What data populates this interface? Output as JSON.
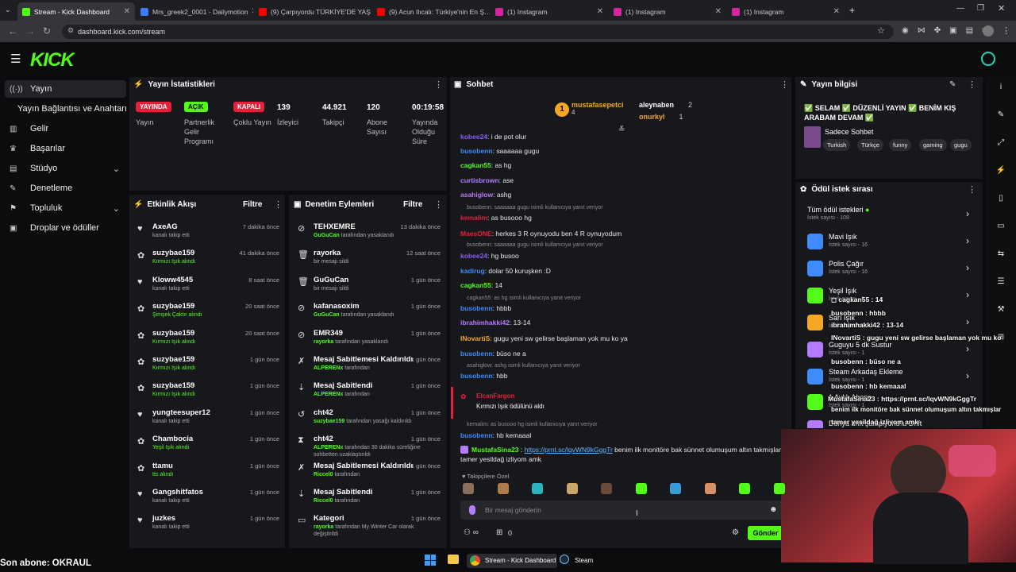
{
  "browser": {
    "tabs": [
      {
        "label": "Stream - Kick Dashboard",
        "color": "#53fc18"
      },
      {
        "label": "Mrs_greek2_0001 - Dailymotion",
        "color": "#3d7bfd"
      },
      {
        "label": "(9) Çarpıyordu TÜRKİYE'DE YAŞ…",
        "color": "#ff0000"
      },
      {
        "label": "(9) Acun Ilıcalı: Türkiye'nin En Ş…",
        "color": "#ff0000"
      },
      {
        "label": "(1) Instagram",
        "color": "#d6249f"
      },
      {
        "label": "(1) Instagram",
        "color": "#d6249f"
      },
      {
        "label": "(1) Instagram",
        "color": "#d6249f"
      }
    ],
    "new_tab": "+",
    "url": "dashboard.kick.com/stream"
  },
  "sidebar": {
    "items": [
      {
        "label": "Yayın",
        "icon": "broadcast-icon"
      },
      {
        "label": "Yayın Bağlantısı ve Anahtarı",
        "icon": ""
      },
      {
        "label": "Gelir",
        "icon": "chart-icon"
      },
      {
        "label": "Başarılar",
        "icon": "trophy-icon"
      },
      {
        "label": "Stüdyo",
        "icon": "studio-icon"
      },
      {
        "label": "Denetleme",
        "icon": "wrench-icon"
      },
      {
        "label": "Topluluk",
        "icon": "community-icon"
      },
      {
        "label": "Droplar ve ödüller",
        "icon": "gift-icon"
      }
    ]
  },
  "stats": {
    "title": "Yayın İstatistikleri",
    "badges": [
      {
        "badge": "YAYINDA",
        "label": "Yayın",
        "color": "#e6203a"
      },
      {
        "badge": "AÇIK",
        "label": "Partnerlik Gelir Programı",
        "color": "#53fc18"
      },
      {
        "badge": "KAPALI",
        "label": "Çoklu Yayın",
        "color": "#e6203a"
      }
    ],
    "numbers": [
      {
        "value": "139",
        "label": "İzleyici"
      },
      {
        "value": "44.921",
        "label": "Takipçi"
      },
      {
        "value": "120",
        "label": "Abone Sayısı"
      },
      {
        "value": "00:19:58",
        "label": "Yayında Olduğu Süre"
      }
    ]
  },
  "activity": {
    "title": "Etkinlik Akışı",
    "filter": "Filtre",
    "rows": [
      {
        "icon": "heart-icon",
        "name": "AxeAG",
        "sub": "kanalı takip etti",
        "time": "7 dakika önce",
        "subcolor": "#aaa"
      },
      {
        "icon": "reward-icon",
        "name": "suzybae159",
        "sub": "Kırmızı Işık alındı",
        "time": "41 dakika önce",
        "subcolor": "#53fc18"
      },
      {
        "icon": "heart-icon",
        "name": "Kloww4545",
        "sub": "kanalı takip etti",
        "time": "8 saat önce",
        "subcolor": "#aaa"
      },
      {
        "icon": "reward-icon",
        "name": "suzybae159",
        "sub": "Şimşek Çaktır alındı",
        "time": "20 saat önce",
        "subcolor": "#53fc18"
      },
      {
        "icon": "reward-icon",
        "name": "suzybae159",
        "sub": "Kırmızı Işık alındı",
        "time": "20 saat önce",
        "subcolor": "#53fc18"
      },
      {
        "icon": "reward-icon",
        "name": "suzybae159",
        "sub": "Kırmızı Işık alındı",
        "time": "1 gün önce",
        "subcolor": "#53fc18"
      },
      {
        "icon": "reward-icon",
        "name": "suzybae159",
        "sub": "Kırmızı Işık alındı",
        "time": "1 gün önce",
        "subcolor": "#53fc18"
      },
      {
        "icon": "heart-icon",
        "name": "yungteesuper12",
        "sub": "kanalı takip etti",
        "time": "1 gün önce",
        "subcolor": "#aaa"
      },
      {
        "icon": "reward-icon",
        "name": "Chambocia",
        "sub": "Yeşil Işık alındı",
        "time": "1 gün önce",
        "subcolor": "#53fc18"
      },
      {
        "icon": "reward-icon",
        "name": "ttamu",
        "sub": "tts alındı",
        "time": "1 gün önce",
        "subcolor": "#53fc18"
      },
      {
        "icon": "heart-icon",
        "name": "Gangshitfatos",
        "sub": "kanalı takip etti",
        "time": "1 gün önce",
        "subcolor": "#aaa"
      },
      {
        "icon": "heart-icon",
        "name": "juzkes",
        "sub": "kanalı takip etti",
        "time": "1 gün önce",
        "subcolor": "#aaa"
      }
    ]
  },
  "moderation": {
    "title": "Denetim Eylemleri",
    "filter": "Filtre",
    "rows": [
      {
        "icon": "ban-icon",
        "name": "TEHXEMRE",
        "sub_user": "GuGuCan",
        "sub": "tarafından yasaklandı",
        "time": "13 dakika önce"
      },
      {
        "icon": "trash-icon",
        "name": "rayorka",
        "sub_user": "",
        "sub": "bir mesajı sildi",
        "time": "12 saat önce"
      },
      {
        "icon": "trash-icon",
        "name": "GuGuCan",
        "sub_user": "",
        "sub": "bir mesajı sildi",
        "time": "1 gün önce"
      },
      {
        "icon": "ban-icon",
        "name": "kafanasoxim",
        "sub_user": "GuGuCan",
        "sub": "tarafından yasaklandı",
        "time": "1 gün önce"
      },
      {
        "icon": "ban-icon",
        "name": "EMR349",
        "sub_user": "rayorka",
        "sub": "tarafından yasaklandı",
        "time": "1 gün önce"
      },
      {
        "icon": "unpin-icon",
        "name": "Mesaj Sabitlemesi Kaldırıldı",
        "sub_user": "ALPERENx",
        "sub": "tarafından",
        "time": "1 gün önce"
      },
      {
        "icon": "pin-icon",
        "name": "Mesaj Sabitlendi",
        "sub_user": "ALPERENx",
        "sub": "tarafından",
        "time": "1 gün önce"
      },
      {
        "icon": "undo-icon",
        "name": "cht42",
        "sub_user": "suzybae159",
        "sub": "tarafından yasağı kaldırıldı",
        "time": "1 gün önce"
      },
      {
        "icon": "timeout-icon",
        "name": "cht42",
        "sub_user": "ALPERENx",
        "sub": "tarafından 30 dakika süreliğine sohbetten uzaklaştırıldı",
        "time": "1 gün önce"
      },
      {
        "icon": "unpin-icon",
        "name": "Mesaj Sabitlemesi Kaldırıldı",
        "sub_user": "Riccel0",
        "sub": "tarafından",
        "time": "1 gün önce"
      },
      {
        "icon": "pin-icon",
        "name": "Mesaj Sabitlendi",
        "sub_user": "Riccel0",
        "sub": "tarafından",
        "time": "1 gün önce"
      },
      {
        "icon": "category-icon",
        "name": "Kategori",
        "sub_user": "rayorka",
        "sub": "tarafından My Winter Car olarak değiştirildi",
        "time": "1 gün önce"
      }
    ]
  },
  "chat": {
    "title": "Sohbet",
    "top_gifters": [
      {
        "name": "mustafasepetci",
        "count": "4",
        "color": "#f5a623"
      },
      {
        "name": "aleynaben",
        "count": "2",
        "color": "#ffffff"
      },
      {
        "name": "onurkyl",
        "count": "1",
        "color": "#f5a623"
      }
    ],
    "messages": [
      {
        "type": "msg",
        "user": "kobee24",
        "text": ": i de pot olur",
        "color": "#8b5cf6"
      },
      {
        "type": "msg",
        "user": "busobenn",
        "text": ": saaaaaa gugu",
        "color": "#3d8bfd"
      },
      {
        "type": "msg",
        "user": "cagkan55",
        "text": ": as hg",
        "color": "#53fc18"
      },
      {
        "type": "msg",
        "user": "curtisbrown",
        "text": ": ase",
        "color": "#b57bff"
      },
      {
        "type": "msg",
        "user": "asahiglow",
        "text": ": ashg",
        "color": "#b57bff"
      },
      {
        "type": "reply",
        "text": "busobenn: saaaaaa gugu isimli kullanıcıya yanıt veriyor"
      },
      {
        "type": "msg",
        "user": "kemalim",
        "text": ": as busooo hg",
        "color": "#e6203a"
      },
      {
        "type": "msg",
        "user": "MaesONE",
        "text": ": herkes 3 R oynuyodu ben 4 R oynuyodum",
        "color": "#e6203a"
      },
      {
        "type": "reply",
        "text": "busobenn: saaaaaa gugu isimli kullanıcıya yanıt veriyor"
      },
      {
        "type": "msg",
        "user": "kobee24",
        "text": ": hg busoo",
        "color": "#8b5cf6"
      },
      {
        "type": "msg",
        "user": "kadirug",
        "text": ": dolar 50 kuruşken :D",
        "color": "#3d8bfd"
      },
      {
        "type": "msg",
        "user": "cagkan55",
        "text": ": 14",
        "color": "#53fc18"
      },
      {
        "type": "reply",
        "text": "cagkan55: as hg isimli kullanıcıya yanıt veriyor"
      },
      {
        "type": "msg",
        "user": "busobenn",
        "text": ": hbbb",
        "color": "#3d8bfd"
      },
      {
        "type": "msg",
        "user": "ibrahimhakki42",
        "text": ": 13-14",
        "color": "#b57bff"
      },
      {
        "type": "msg",
        "user": "INovartiS",
        "text": ": gugu yeni sw gelirse başlaman yok mu ko ya",
        "color": "#f5a623"
      },
      {
        "type": "msg",
        "user": "busobenn",
        "text": ": büso ne a",
        "color": "#3d8bfd"
      },
      {
        "type": "reply",
        "text": "asahiglow: ashg isimli kullanıcıya yanıt veriyor"
      },
      {
        "type": "msg",
        "user": "busobenn",
        "text": ": hbb",
        "color": "#3d8bfd"
      }
    ],
    "redeem": {
      "user": "ElcanFargon",
      "text": "Kırmızı Işık ödülünü aldı"
    },
    "messages2": [
      {
        "type": "reply",
        "text": "kemalim: as busooo hg isimli kullanıcıya yanıt veriyor"
      },
      {
        "type": "msg",
        "user": "busobenn",
        "text": ": hb kemaaal",
        "color": "#3d8bfd"
      }
    ],
    "last": {
      "user": "MustafaSina23",
      "link": "https://prnt.sc/lqvWN9kGggTr",
      "text": " benim ilk monitöre bak sünnet olumuşum altın takmışlar",
      "text2": "tamer yesildağ izliyom amk"
    },
    "emote_label": "Takipçilere Özel",
    "input_placeholder": "Bir mesaj gönderin",
    "points": "0",
    "send": "Gönder"
  },
  "stream_info": {
    "title": "Yayın bilgisi",
    "stream_title": "✅ SELAM ✅ DÜZENLİ YAYIN ✅ BENİM KIŞ ARABAM DEVAM ✅",
    "category": "Sadece Sohbet",
    "tags": [
      "Turkish",
      "Türkçe",
      "funny",
      "gaming",
      "gugu"
    ]
  },
  "rewards": {
    "title": "Ödül istek sırası",
    "all": {
      "title": "Tüm ödül istekleri",
      "sub": "İstek sayısı - 108"
    },
    "items": [
      {
        "title": "Mavi Işık",
        "sub": "İstek sayısı - 16",
        "color": "#3d8bfd"
      },
      {
        "title": "Polis Çağır",
        "sub": "İstek sayısı - 16",
        "color": "#3d8bfd"
      },
      {
        "title": "Yeşil Işık",
        "sub": "İstek sayısı - 5",
        "color": "#53fc18"
      },
      {
        "title": "Sarı Işık",
        "sub": "İstek sayısı - 2",
        "color": "#f5a623"
      },
      {
        "title": "Guguyu 5 dk Sustur",
        "sub": "İstek sayısı - 1",
        "color": "#b57bff"
      },
      {
        "title": "Steam Arkadaş Ekleme",
        "sub": "İstek sayısı - 1",
        "color": "#3d8bfd"
      },
      {
        "title": "1 Aylık Abone",
        "sub": "İstek sayısı - 1",
        "color": "#53fc18"
      },
      {
        "title": "Dünya drift şampiyonu'lu Drift",
        "sub": "",
        "color": "#b57bff"
      }
    ]
  },
  "overlay": {
    "lines": [
      {
        "text": "◻ cagkan55 : 14"
      },
      {
        "text": "busobenn : hbbb"
      },
      {
        "text": "ibrahimhakki42 : 13-14"
      },
      {
        "text": "INovartiS : gugu yeni sw gelirse başlaman yok mu ko"
      },
      {
        "text": "busobenn : büso ne a"
      },
      {
        "text": "busobenn : hb kemaaal"
      },
      {
        "text": "MustafaSina23 : https://prnt.sc/lqvWN9kGggTr"
      },
      {
        "text": "benim ilk monitöre bak sünnet olumuşum altın takmışlar"
      },
      {
        "text": "tamer yesildağ izliyom amk"
      }
    ],
    "last_sub": "Son abone: OKRAUL"
  },
  "taskbar": {
    "items": [
      {
        "label": "Stream - Kick Dashboard"
      },
      {
        "label": "Steam"
      }
    ]
  }
}
